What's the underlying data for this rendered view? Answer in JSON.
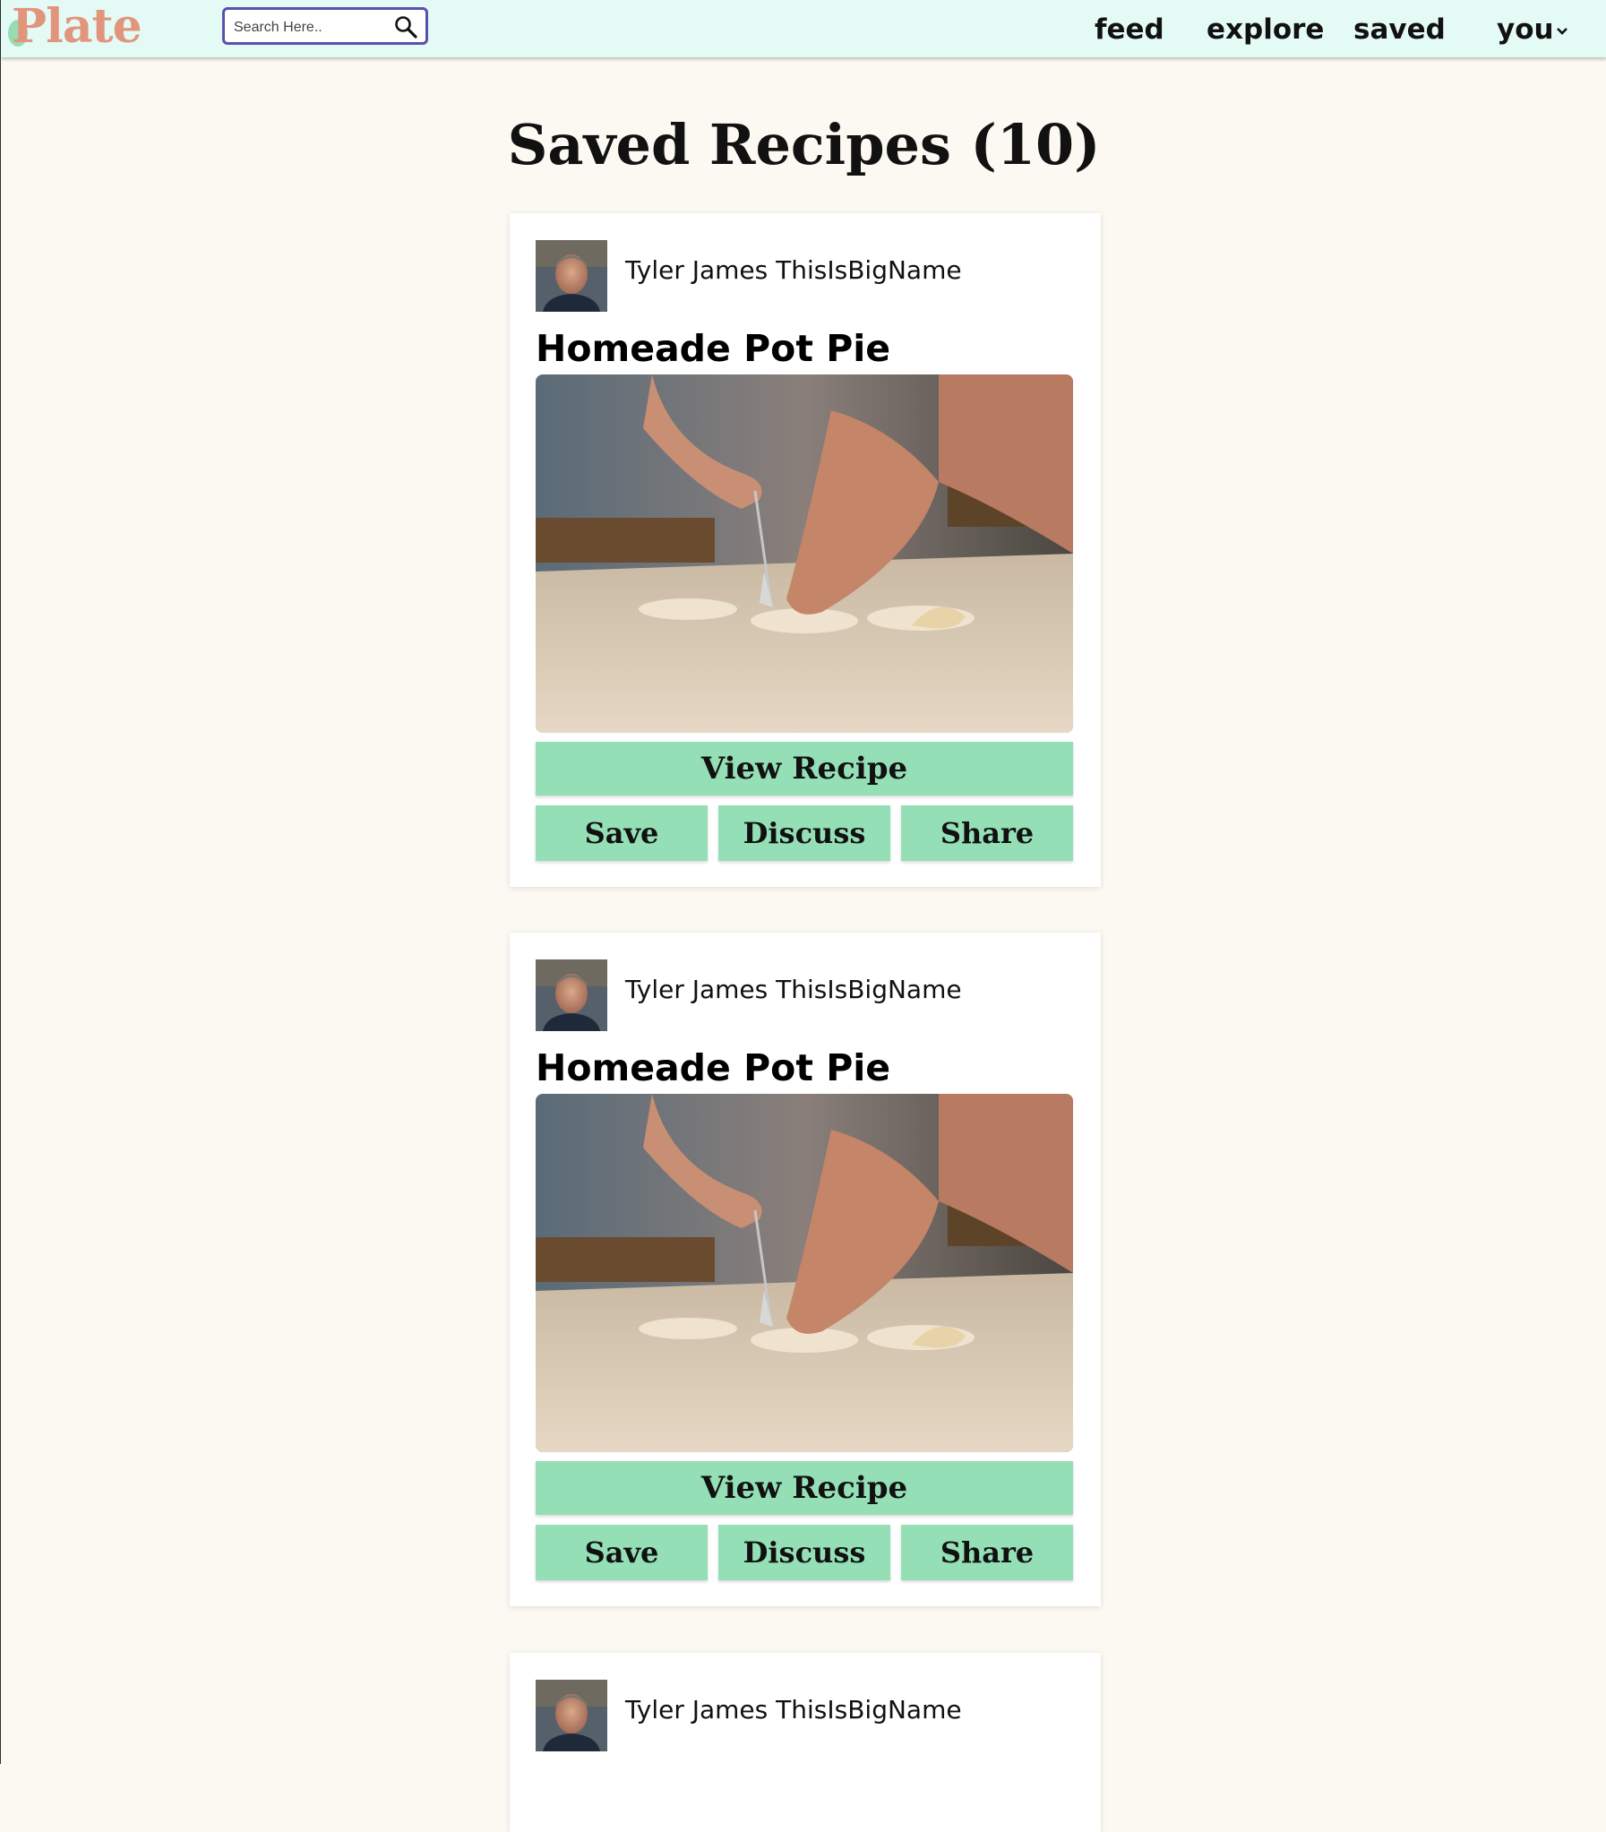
{
  "app": {
    "logo": "Plate"
  },
  "search": {
    "placeholder": "Search Here.."
  },
  "nav": {
    "items": [
      {
        "label": "feed"
      },
      {
        "label": "explore"
      },
      {
        "label": "saved"
      },
      {
        "label": "you"
      }
    ]
  },
  "page": {
    "title": "Saved Recipes (10)"
  },
  "recipes": [
    {
      "author": "Tyler James ThisIsBigName",
      "title": "Homeade Pot Pie",
      "view_label": "View Recipe",
      "save_label": "Save",
      "discuss_label": "Discuss",
      "share_label": "Share"
    },
    {
      "author": "Tyler James ThisIsBigName",
      "title": "Homeade Pot Pie",
      "view_label": "View Recipe",
      "save_label": "Save",
      "discuss_label": "Discuss",
      "share_label": "Share"
    },
    {
      "author": "Tyler James ThisIsBigName"
    }
  ],
  "colors": {
    "navbar_bg": "#e4fbf5",
    "page_bg": "#fcf9f3",
    "logo": "#e2957d",
    "button_bg": "#94dfb6",
    "search_border": "#5b4fb0"
  }
}
